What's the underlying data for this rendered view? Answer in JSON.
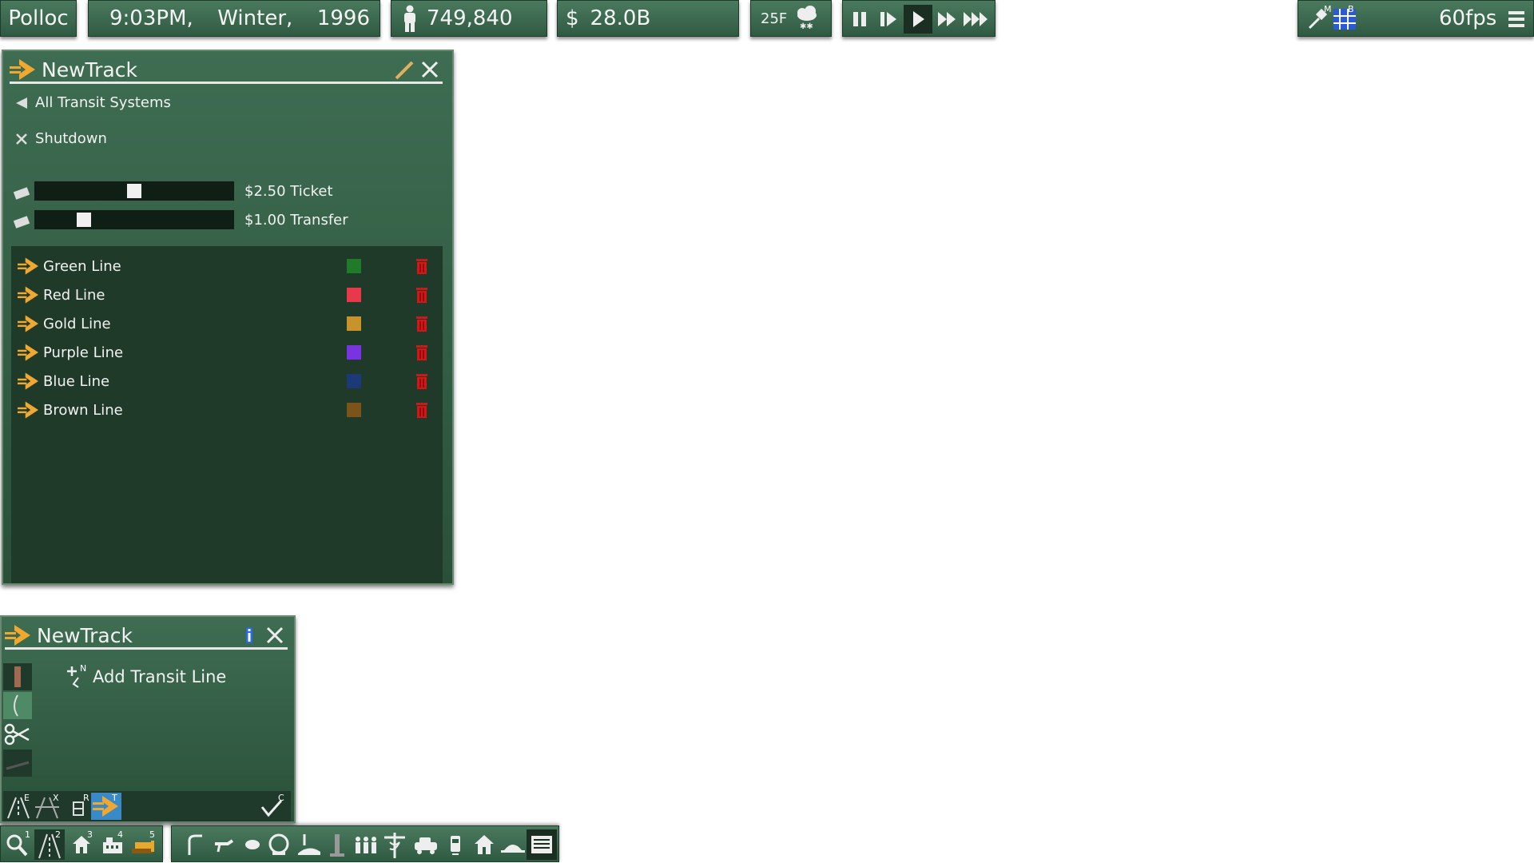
{
  "topbar": {
    "city": "Polloc",
    "time": "9:03PM,",
    "season": "Winter,",
    "year": "1996",
    "population": "749,840",
    "money_symbol": "$",
    "money": "28.0B",
    "temperature": "25F",
    "fps": "60fps",
    "overlay_m": "M",
    "overlay_b": "B"
  },
  "panel_main": {
    "title": "NewTrack",
    "back_label": "All Transit Systems",
    "shutdown_label": "Shutdown",
    "ticket_label": "$2.50 Ticket",
    "transfer_label": "$1.00 Transfer",
    "ticket_level": 0.5,
    "transfer_level": 0.23,
    "lines": [
      {
        "name": "Green Line",
        "color": "#1f7a2a"
      },
      {
        "name": "Red Line",
        "color": "#e8394a"
      },
      {
        "name": "Gold Line",
        "color": "#c8932a"
      },
      {
        "name": "Purple Line",
        "color": "#7a33e0"
      },
      {
        "name": "Blue Line",
        "color": "#1d3a78"
      },
      {
        "name": "Brown Line",
        "color": "#7a5418"
      }
    ]
  },
  "panel_tool": {
    "title": "NewTrack",
    "add_line_label": "Add Transit Line",
    "add_key": "N",
    "mode_keys": [
      "E",
      "X",
      "R",
      "T"
    ],
    "confirm_key": "C"
  },
  "bottombar": {
    "keys": [
      "1",
      "2",
      "3",
      "4",
      "5"
    ]
  },
  "colors": {
    "panel": "#2f5a42",
    "list_bg": "#203a2a",
    "accent": "#f0a830",
    "trash": "#d01818"
  }
}
